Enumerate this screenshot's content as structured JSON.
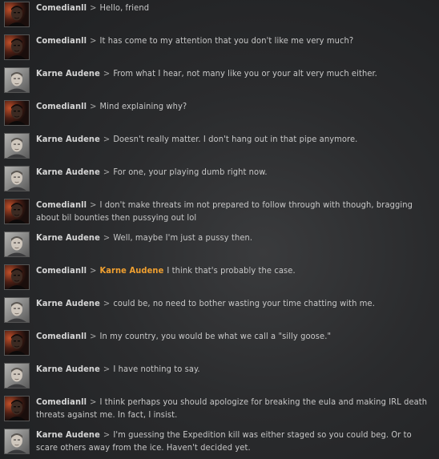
{
  "messages": [
    {
      "speaker": "Comedianll",
      "avatar": "comedian-portrait",
      "separator": ">",
      "text": "Hello, friend"
    },
    {
      "speaker": "Comedianll",
      "avatar": "comedian-portrait",
      "separator": ">",
      "text": "It has come to my attention that you don't like me very much?"
    },
    {
      "speaker": "Karne Audene",
      "avatar": "karne-portrait",
      "separator": ">",
      "text": "From what I hear, not many like you or your alt very much either."
    },
    {
      "speaker": "Comedianll",
      "avatar": "comedian-portrait",
      "separator": ">",
      "text": "Mind explaining why?"
    },
    {
      "speaker": "Karne Audene",
      "avatar": "karne-portrait",
      "separator": ">",
      "text": "Doesn't really matter. I don't hang out in that pipe anymore."
    },
    {
      "speaker": "Karne Audene",
      "avatar": "karne-portrait",
      "separator": ">",
      "text": "For one, your playing dumb right now."
    },
    {
      "speaker": "Comedianll",
      "avatar": "comedian-portrait",
      "separator": ">",
      "text": "I don't make threats im not prepared to follow through with though, bragging about bil bounties then pussying out lol"
    },
    {
      "speaker": "Karne Audene",
      "avatar": "karne-portrait",
      "separator": ">",
      "text": "Well, maybe I'm just a pussy then."
    },
    {
      "speaker": "Comedianll",
      "avatar": "comedian-portrait",
      "separator": ">",
      "link": "Karne Audene",
      "text": "I think that's probably the case."
    },
    {
      "speaker": "Karne Audene",
      "avatar": "karne-portrait",
      "separator": ">",
      "text": "could be, no need to bother wasting your time chatting with me."
    },
    {
      "speaker": "Comedianll",
      "avatar": "comedian-portrait",
      "separator": ">",
      "text": "In my country, you would be what we call a \"silly goose.\""
    },
    {
      "speaker": "Karne Audene",
      "avatar": "karne-portrait",
      "separator": ">",
      "text": "I have nothing to say."
    },
    {
      "speaker": "Comedianll",
      "avatar": "comedian-portrait",
      "separator": ">",
      "text": "I think perhaps you should apologize for breaking the eula and making IRL death threats against me. In fact, I insist."
    },
    {
      "speaker": "Karne Audene",
      "avatar": "karne-portrait",
      "separator": ">",
      "text": "I'm guessing the Expedition kill was either staged so you could beg. Or to scare others away from the ice. Haven't decided yet."
    }
  ],
  "colors": {
    "speaker": "#d6d6d6",
    "text": "#c8c8c8",
    "link": "#f0a030",
    "background": "#2a2b2d"
  }
}
